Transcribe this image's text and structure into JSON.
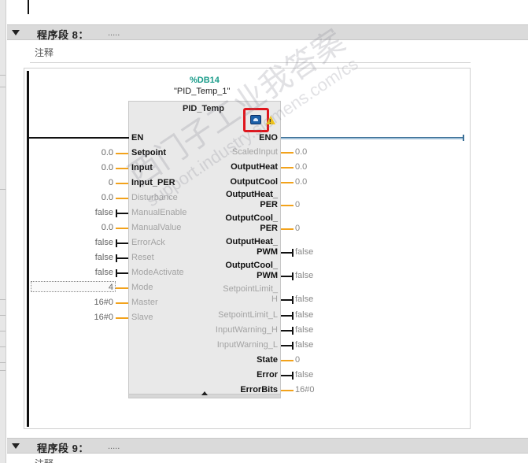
{
  "segment8": {
    "title": "程序段 8：",
    "dots": ".....",
    "comment": "注释"
  },
  "segment9": {
    "title": "程序段 9：",
    "dots": ".....",
    "comment": "注释"
  },
  "block": {
    "db_number": "%DB14",
    "instance_name": "\"PID_Temp_1\"",
    "type": "PID_Temp",
    "en": "EN",
    "eno": "ENO"
  },
  "inputs": [
    {
      "name": "Setpoint",
      "value": "0.0",
      "active": true
    },
    {
      "name": "Input",
      "value": "0.0",
      "active": true
    },
    {
      "name": "Input_PER",
      "value": "0",
      "active": true
    },
    {
      "name": "Disturbance",
      "value": "0.0",
      "active": false
    },
    {
      "name": "ManualEnable",
      "value": "false",
      "active": false
    },
    {
      "name": "ManualValue",
      "value": "0.0",
      "active": false
    },
    {
      "name": "ErrorAck",
      "value": "false",
      "active": false
    },
    {
      "name": "Reset",
      "value": "false",
      "active": false
    },
    {
      "name": "ModeActivate",
      "value": "false",
      "active": false
    },
    {
      "name": "Mode",
      "value": "4",
      "active": false
    },
    {
      "name": "Master",
      "value": "16#0",
      "active": false
    },
    {
      "name": "Slave",
      "value": "16#0",
      "active": false
    }
  ],
  "outputs": [
    {
      "line1": "ScaledInput",
      "line2": "",
      "value": "0.0",
      "active": false
    },
    {
      "line1": "OutputHeat",
      "line2": "",
      "value": "0.0",
      "active": true
    },
    {
      "line1": "OutputCool",
      "line2": "",
      "value": "0.0",
      "active": true
    },
    {
      "line1": "OutputHeat_",
      "line2": "PER",
      "value": "0",
      "active": true
    },
    {
      "line1": "OutputCool_",
      "line2": "PER",
      "value": "0",
      "active": true
    },
    {
      "line1": "OutputHeat_",
      "line2": "PWM",
      "value": "false",
      "active": true
    },
    {
      "line1": "OutputCool_",
      "line2": "PWM",
      "value": "false",
      "active": true
    },
    {
      "line1": "SetpointLimit_",
      "line2": "H",
      "value": "false",
      "active": false
    },
    {
      "line1": "SetpointLimit_L",
      "line2": "",
      "value": "false",
      "active": false
    },
    {
      "line1": "InputWarning_H",
      "line2": "",
      "value": "false",
      "active": false
    },
    {
      "line1": "InputWarning_L",
      "line2": "",
      "value": "false",
      "active": false
    },
    {
      "line1": "State",
      "line2": "",
      "value": "0",
      "active": true
    },
    {
      "line1": "Error",
      "line2": "",
      "value": "false",
      "active": true
    },
    {
      "line1": "ErrorBits",
      "line2": "",
      "value": "16#0",
      "active": true
    }
  ],
  "icons": {
    "config": "pid-config-icon",
    "warning": "warning-icon"
  },
  "colors": {
    "db_number": "#1a9c8a",
    "wire_value": "#f2a21b",
    "highlight": "#e0161d"
  },
  "watermark": {
    "line1": "西门子工业我答案",
    "line2": "support.industry.siemens.com/cs"
  }
}
